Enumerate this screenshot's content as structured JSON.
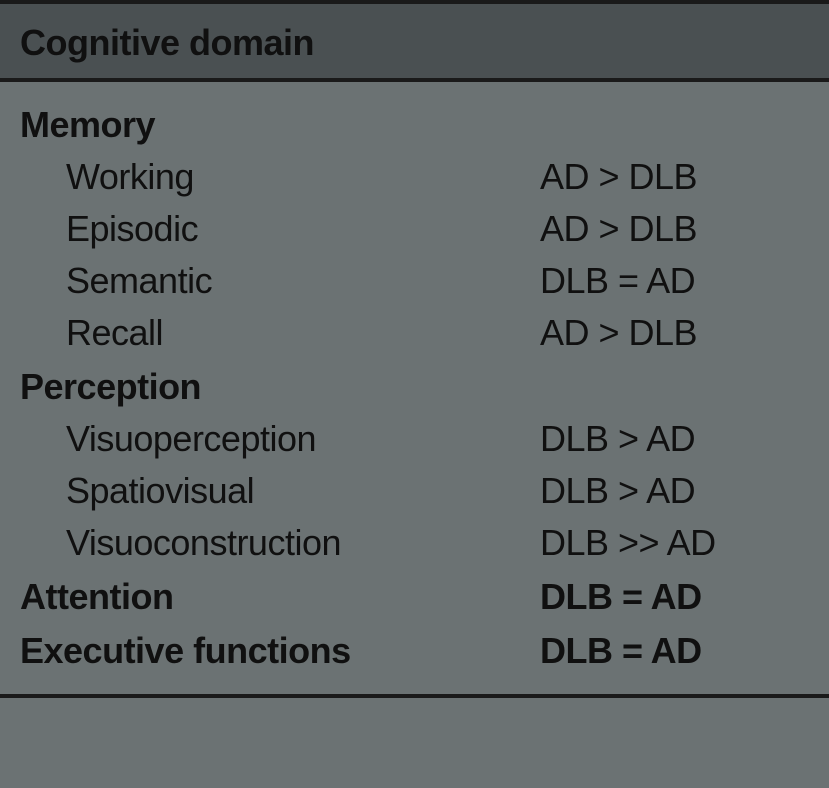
{
  "header": "Cognitive domain",
  "sections": [
    {
      "label": "Memory",
      "value": "",
      "items": [
        {
          "label": "Working",
          "value": "AD > DLB"
        },
        {
          "label": "Episodic",
          "value": "AD > DLB"
        },
        {
          "label": "Semantic",
          "value": "DLB = AD"
        },
        {
          "label": "Recall",
          "value": "AD > DLB"
        }
      ]
    },
    {
      "label": "Perception",
      "value": "",
      "items": [
        {
          "label": "Visuoperception",
          "value": "DLB > AD"
        },
        {
          "label": "Spatiovisual",
          "value": "DLB > AD"
        },
        {
          "label": "Visuoconstruction",
          "value": "DLB >> AD"
        }
      ]
    },
    {
      "label": "Attention",
      "value": "DLB = AD",
      "items": []
    },
    {
      "label": "Executive functions",
      "value": "DLB = AD",
      "items": []
    }
  ]
}
